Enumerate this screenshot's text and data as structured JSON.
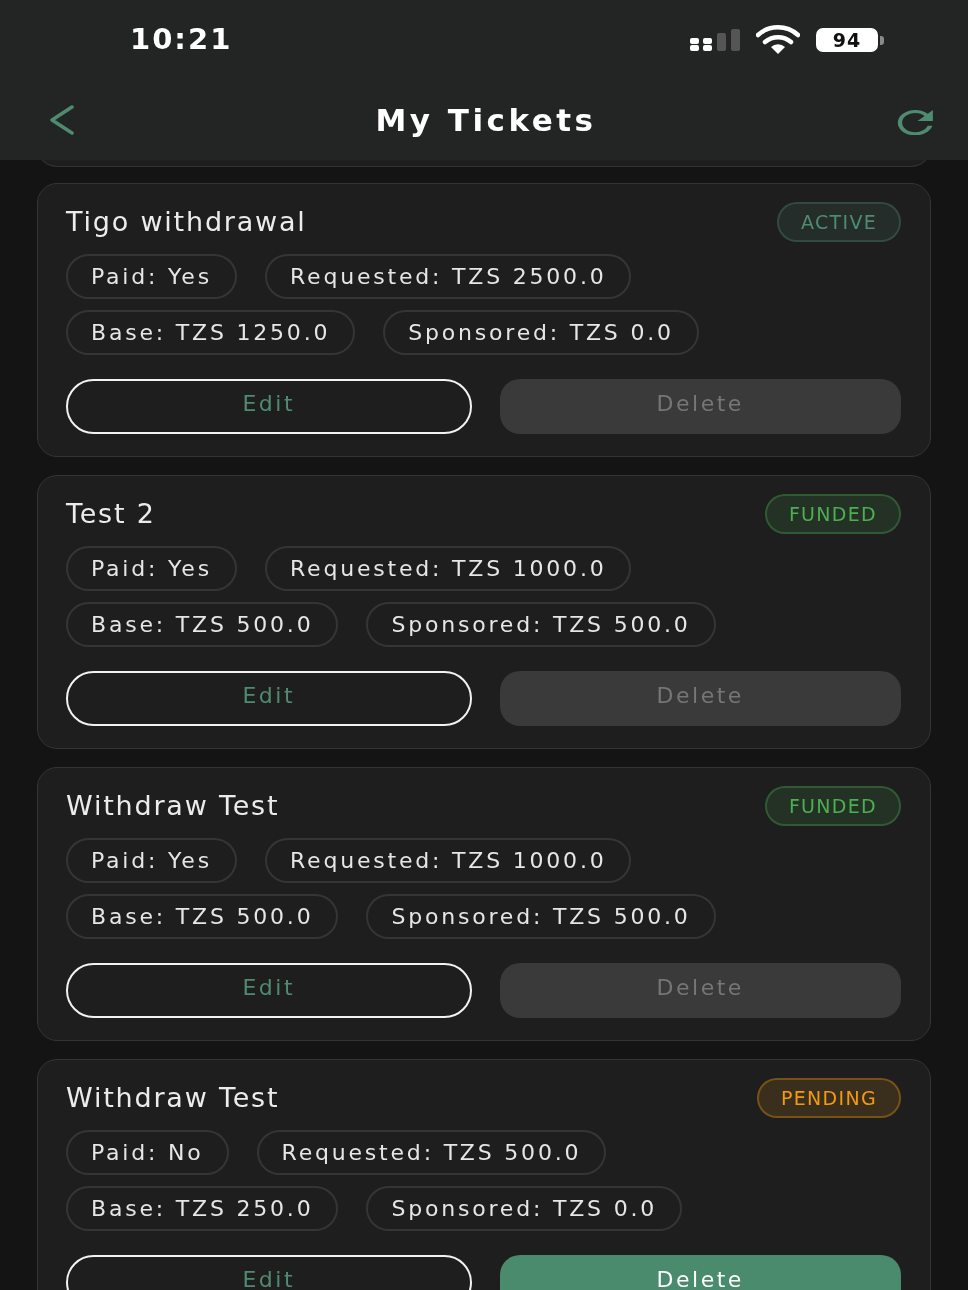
{
  "status_bar": {
    "time": "10:21",
    "battery": "94"
  },
  "header": {
    "title": "My Tickets"
  },
  "tickets": [
    {
      "title": "Tigo withdrawal",
      "status": {
        "label": "ACTIVE",
        "color": "#4e8b70"
      },
      "chip_rows": [
        [
          "Paid: Yes",
          "Requested: TZS 2500.0"
        ],
        [
          "Base: TZS 1250.0",
          "Sponsored: TZS 0.0"
        ]
      ],
      "edit": {
        "label": "Edit"
      },
      "delete": {
        "label": "Delete",
        "disabled": true
      }
    },
    {
      "title": "Test 2",
      "status": {
        "label": "FUNDED",
        "color": "#4caf50"
      },
      "chip_rows": [
        [
          "Paid: Yes",
          "Requested: TZS 1000.0"
        ],
        [
          "Base: TZS 500.0",
          "Sponsored: TZS 500.0"
        ]
      ],
      "edit": {
        "label": "Edit"
      },
      "delete": {
        "label": "Delete",
        "disabled": true
      }
    },
    {
      "title": "Withdraw Test",
      "status": {
        "label": "FUNDED",
        "color": "#4caf50"
      },
      "chip_rows": [
        [
          "Paid: Yes",
          "Requested: TZS 1000.0"
        ],
        [
          "Base: TZS 500.0",
          "Sponsored: TZS 500.0"
        ]
      ],
      "edit": {
        "label": "Edit"
      },
      "delete": {
        "label": "Delete",
        "disabled": true
      }
    },
    {
      "title": "Withdraw Test",
      "status": {
        "label": "PENDING",
        "color": "#f29a12"
      },
      "chip_rows": [
        [
          "Paid: No",
          "Requested: TZS 500.0"
        ],
        [
          "Base: TZS 250.0",
          "Sponsored: TZS 0.0"
        ]
      ],
      "edit": {
        "label": "Edit"
      },
      "delete": {
        "label": "Delete",
        "disabled": false
      }
    }
  ]
}
